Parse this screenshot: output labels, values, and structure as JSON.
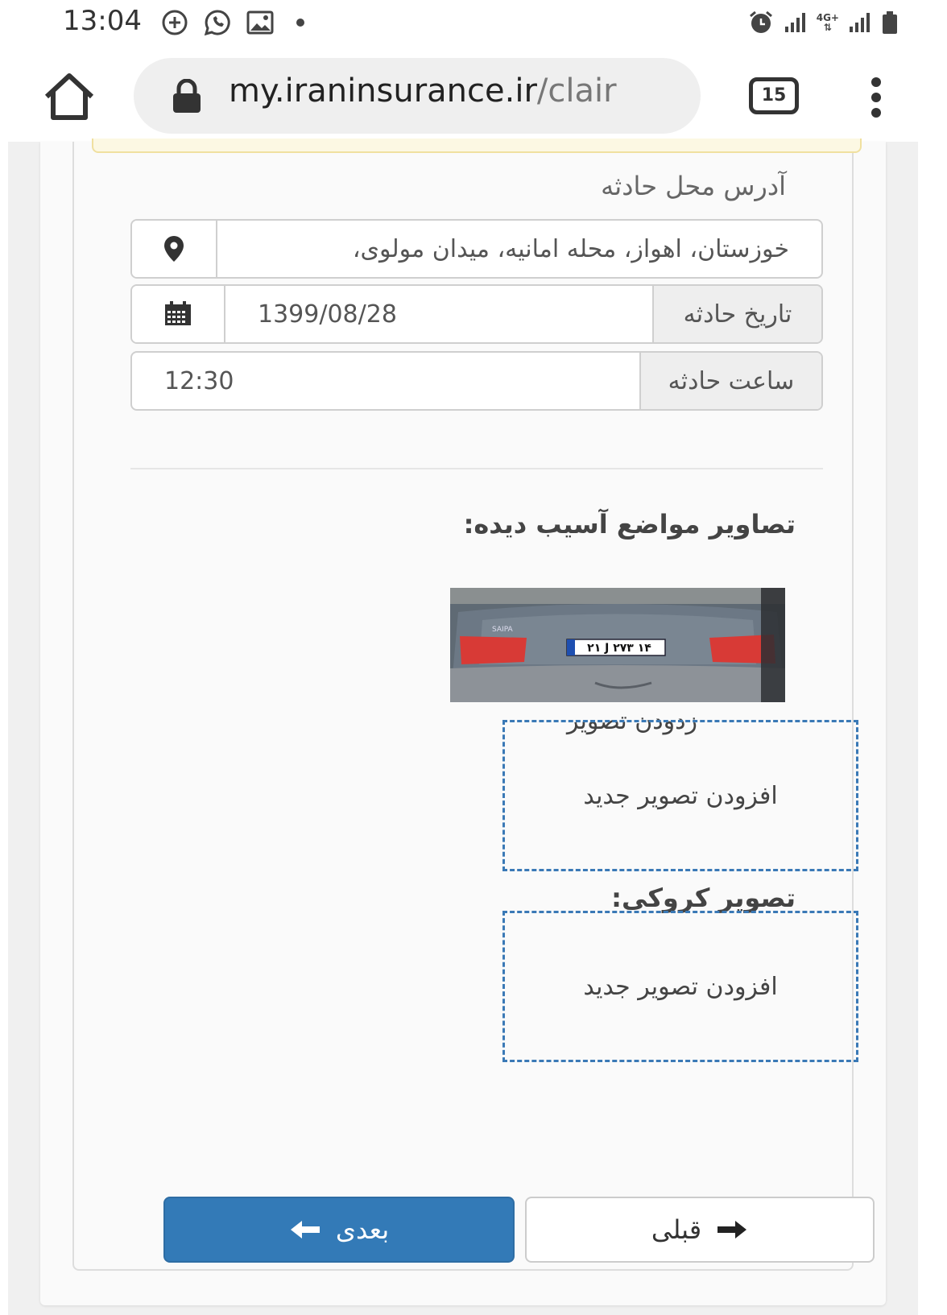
{
  "status_bar": {
    "time": "13:04",
    "network_label": "4G+",
    "icons_left": [
      "add-circle-icon",
      "whatsapp-icon",
      "image-icon",
      "dot-icon"
    ],
    "icons_right": [
      "alarm-icon",
      "signal-icon",
      "signal-4g-icon",
      "battery-icon"
    ]
  },
  "browser": {
    "url_domain": "my.iraninsurance.ir",
    "url_path": "/clair",
    "tab_count": "15"
  },
  "form": {
    "address_label": "آدرس محل حادثه",
    "address_value": "خوزستان، اهواز، محله امانیه، میدان مولوی،",
    "date_label": "تاریخ حادثه",
    "date_value": "1399/08/28",
    "time_label": "ساعت حادثه",
    "time_value": "12:30"
  },
  "damage_images": {
    "title": "تصاویر مواضع آسیب دیده:",
    "remove_label": "زدودن تصویر",
    "plate_text": "۲۱ J ۲۷۳ ۱۴",
    "car_badge": "SAIPA",
    "add_label": "افزودن تصویر جدید"
  },
  "sketch_image": {
    "title": "تصویر کروکی:",
    "add_label": "افزودن تصویر جدید"
  },
  "buttons": {
    "next_label": "بعدی",
    "prev_label": "قبلی"
  },
  "colors": {
    "primary": "#337ab7",
    "dashed_border": "#3a79b6",
    "alert_bg": "#fcf8e3"
  }
}
